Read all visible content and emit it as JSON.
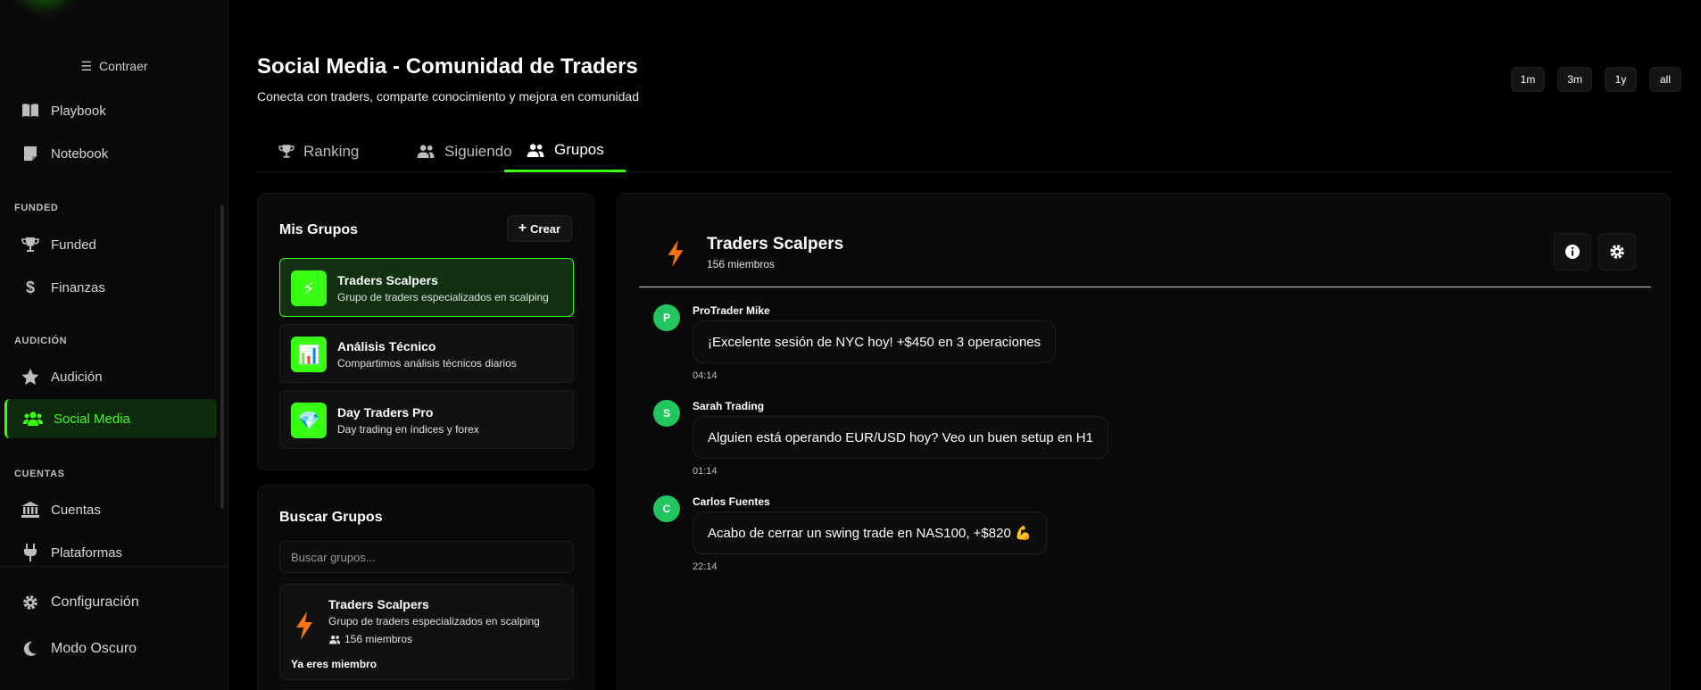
{
  "sidebar": {
    "collapse_label": "Contraer",
    "items": [
      {
        "label": "Playbook",
        "icon": "book-icon"
      },
      {
        "label": "Notebook",
        "icon": "note-icon"
      },
      {
        "label": "Funded",
        "icon": "trophy-icon"
      },
      {
        "label": "Finanzas",
        "icon": "dollar-icon"
      },
      {
        "label": "Audición",
        "icon": "star-icon"
      },
      {
        "label": "Social Media",
        "icon": "users-icon",
        "active": true
      },
      {
        "label": "Cuentas",
        "icon": "bank-icon"
      },
      {
        "label": "Plataformas",
        "icon": "plug-icon"
      }
    ],
    "sections": {
      "funded": "FUNDED",
      "audicion": "AUDICIÓN",
      "cuentas": "CUENTAS"
    },
    "bottom": [
      {
        "label": "Configuración",
        "icon": "gear-icon"
      },
      {
        "label": "Modo Oscuro",
        "icon": "moon-icon"
      }
    ]
  },
  "header": {
    "title": "Social Media - Comunidad de Traders",
    "subtitle": "Conecta con traders, comparte conocimiento y mejora en comunidad",
    "ranges": [
      "1m",
      "3m",
      "1y",
      "all"
    ]
  },
  "tabs": [
    {
      "label": "Ranking",
      "icon": "trophy-icon"
    },
    {
      "label": "Siguiendo",
      "icon": "users-icon"
    },
    {
      "label": "Grupos",
      "icon": "users-icon",
      "active": true
    }
  ],
  "my_groups": {
    "title": "Mis Grupos",
    "create_label": "Crear",
    "groups": [
      {
        "name": "Traders Scalpers",
        "desc": "Grupo de traders especializados en scalping",
        "icon": "lightning-icon",
        "emoji": "⚡",
        "active": true
      },
      {
        "name": "Análisis Técnico",
        "desc": "Compartimos análisis técnicos diarios",
        "icon": "chart-icon",
        "emoji": "📊"
      },
      {
        "name": "Day Traders Pro",
        "desc": "Day trading en índices y forex",
        "icon": "diamond-icon",
        "emoji": "💎"
      }
    ]
  },
  "search_groups": {
    "title": "Buscar Grupos",
    "placeholder": "Buscar grupos...",
    "result": {
      "name": "Traders Scalpers",
      "desc": "Grupo de traders especializados en scalping",
      "members": "156 miembros",
      "status": "Ya eres miembro"
    }
  },
  "chat": {
    "group_name": "Traders Scalpers",
    "members": "156 miembros",
    "messages": [
      {
        "initial": "P",
        "author": "ProTrader Mike",
        "text": "¡Excelente sesión de NYC hoy! +$450 en 3 operaciones",
        "time": "04:14"
      },
      {
        "initial": "S",
        "author": "Sarah Trading",
        "text": "Alguien está operando EUR/USD hoy? Veo un buen setup en H1",
        "time": "01:14"
      },
      {
        "initial": "C",
        "author": "Carlos Fuentes",
        "text": "Acabo de cerrar un swing trade en NAS100, +$820 💪",
        "time": "22:14"
      }
    ]
  },
  "colors": {
    "accent": "#39ff14",
    "avatar": "#22c55e",
    "bolt": "#f97316"
  }
}
